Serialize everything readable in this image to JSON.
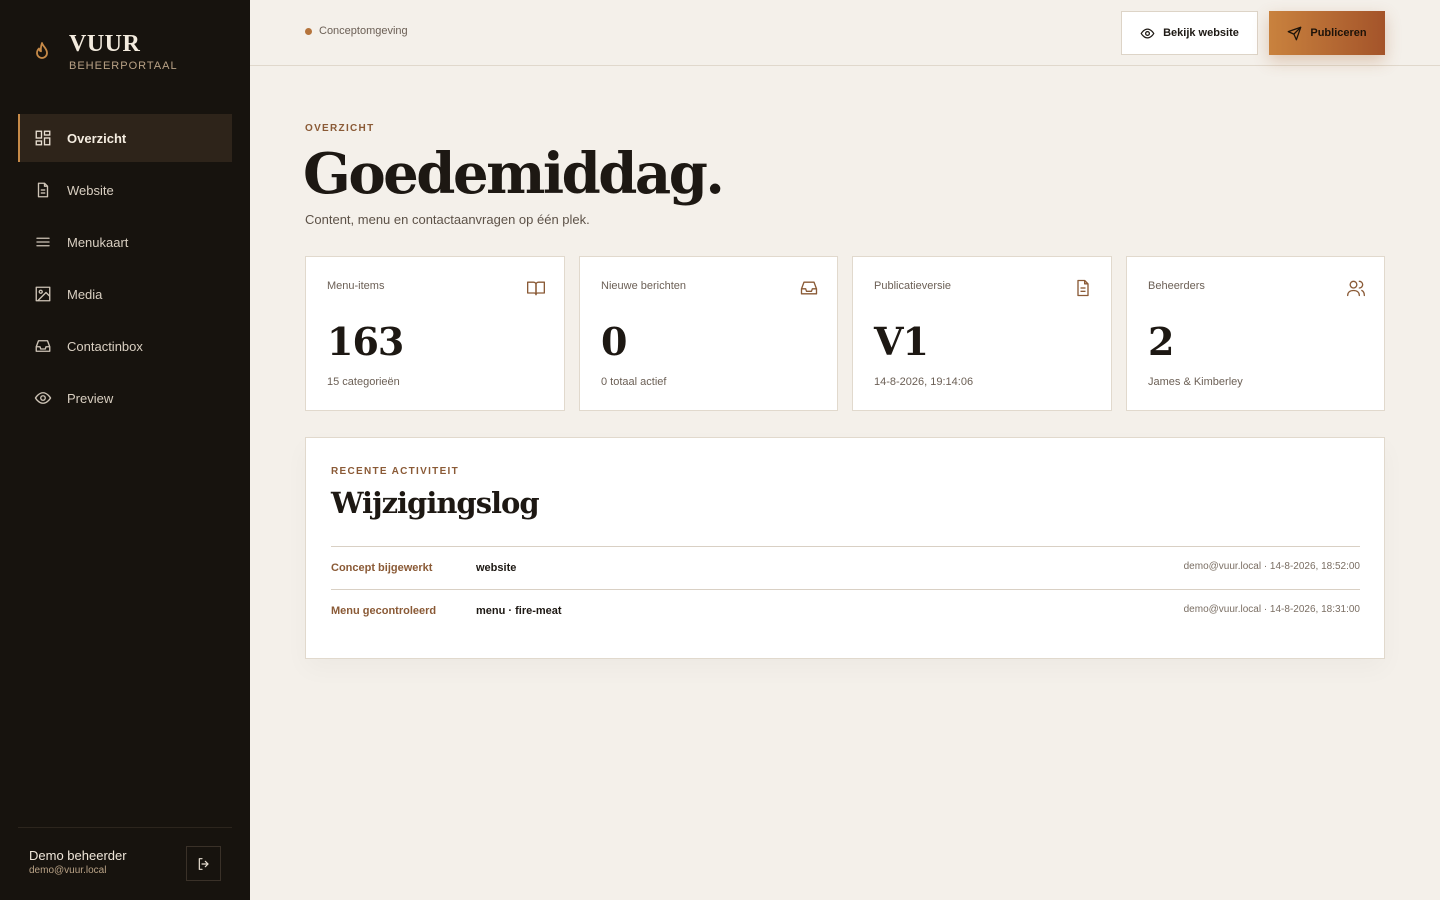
{
  "brand": {
    "title": "VUUR",
    "subtitle": "BEHEERPORTAAL"
  },
  "sidebar": {
    "items": [
      {
        "label": "Overzicht",
        "icon": "dashboard-icon",
        "active": true
      },
      {
        "label": "Website",
        "icon": "file-text-icon"
      },
      {
        "label": "Menukaart",
        "icon": "menu-lines-icon"
      },
      {
        "label": "Media",
        "icon": "image-icon"
      },
      {
        "label": "Contactinbox",
        "icon": "inbox-icon"
      },
      {
        "label": "Preview",
        "icon": "eye-icon"
      }
    ]
  },
  "user": {
    "name": "Demo beheerder",
    "email": "demo@vuur.local"
  },
  "topbar": {
    "environment": "Conceptomgeving",
    "view_label": "Bekijk website",
    "publish_label": "Publiceren"
  },
  "header": {
    "eyebrow": "OVERZICHT",
    "title": "Goedemiddag.",
    "subtitle": "Content, menu en contactaanvragen op één plek."
  },
  "stats": [
    {
      "label": "Menu-items",
      "value": "163",
      "sub": "15 categorieën",
      "icon": "book-icon"
    },
    {
      "label": "Nieuwe berichten",
      "value": "0",
      "sub": "0 totaal actief",
      "icon": "inbox-icon"
    },
    {
      "label": "Publicatieversie",
      "value": "V1",
      "sub": "14-8-2026, 19:14:06",
      "icon": "file-text-icon"
    },
    {
      "label": "Beheerders",
      "value": "2",
      "sub": "James & Kimberley",
      "icon": "users-icon"
    }
  ],
  "activity": {
    "eyebrow": "RECENTE ACTIVITEIT",
    "title": "Wijzigingslog",
    "rows": [
      {
        "action": "Concept bijgewerkt",
        "target": "website",
        "meta": "demo@vuur.local · 14-8-2026, 18:52:00"
      },
      {
        "action": "Menu gecontroleerd",
        "target": "menu · fire-meat",
        "meta": "demo@vuur.local · 14-8-2026, 18:31:00"
      }
    ]
  },
  "colors": {
    "accent": "#c68a48",
    "sidebar_bg": "#17130e",
    "page_bg": "#f4f0ea",
    "eyebrow": "#8a5a36"
  }
}
